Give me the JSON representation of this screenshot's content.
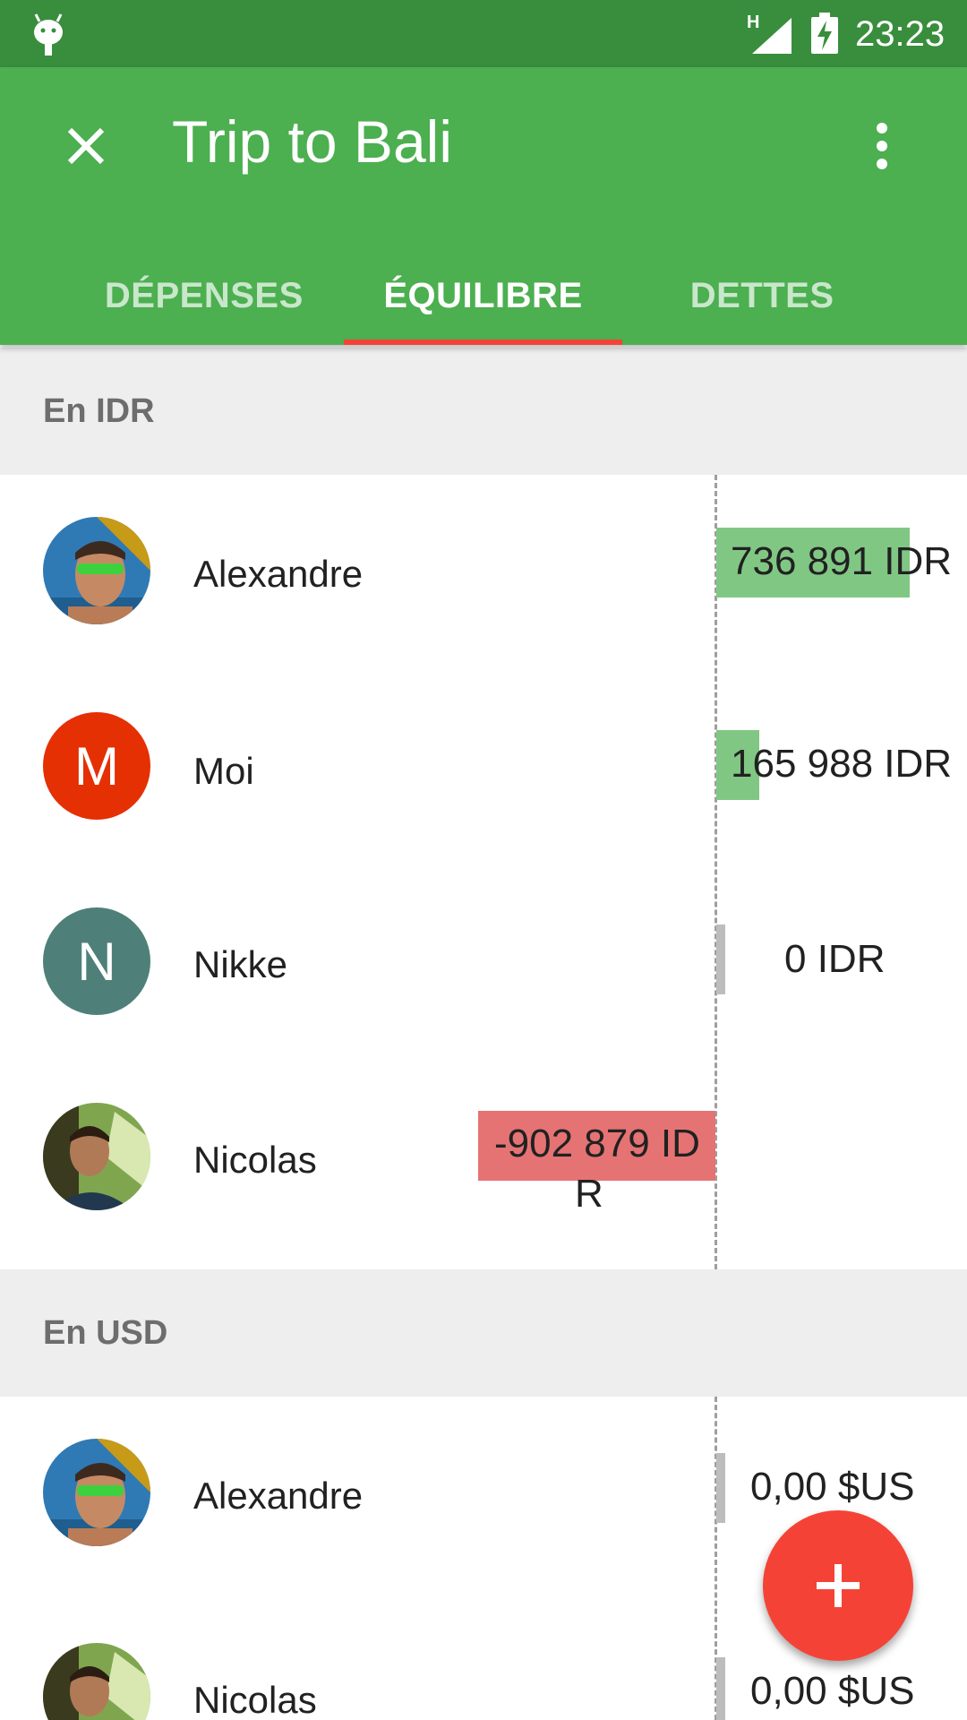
{
  "status_bar": {
    "network": "H",
    "time": "23:23"
  },
  "app_bar": {
    "title": "Trip to Bali",
    "icons": {
      "close": "close-icon",
      "menu": "more-vert-icon"
    }
  },
  "tabs": [
    {
      "label": "DÉPENSES",
      "active": false
    },
    {
      "label": "ÉQUILIBRE",
      "active": true
    },
    {
      "label": "DETTES",
      "active": false
    }
  ],
  "sections": [
    {
      "header": "En IDR",
      "rows": [
        {
          "name": "Alexandre",
          "amount": "736 891 IDR",
          "value": 736891,
          "avatar": "photo"
        },
        {
          "name": "Moi",
          "amount": "165 988 IDR",
          "value": 165988,
          "avatar_letter": "M",
          "avatar_color": "#e53003"
        },
        {
          "name": "Nikke",
          "amount": "0 IDR",
          "value": 0,
          "avatar_letter": "N",
          "avatar_color": "#4e8079"
        },
        {
          "name": "Nicolas",
          "amount_line1": "-902 879 ID",
          "amount_line2": "R",
          "value": -902879,
          "avatar": "photo"
        }
      ]
    },
    {
      "header": "En USD",
      "rows": [
        {
          "name": "Alexandre",
          "amount": "0,00 $US",
          "value": 0,
          "avatar": "photo"
        },
        {
          "name": "Nicolas",
          "amount": "0,00 $US",
          "value": 0,
          "avatar": "photo"
        }
      ]
    }
  ],
  "colors": {
    "primary": "#4caf50",
    "primary_dark": "#388e3c",
    "accent": "#f44336",
    "positive_bar": "#81c784",
    "negative_bar": "#e57373",
    "zero_bar": "#bdbdbd"
  },
  "fab": {
    "icon": "plus-icon"
  }
}
